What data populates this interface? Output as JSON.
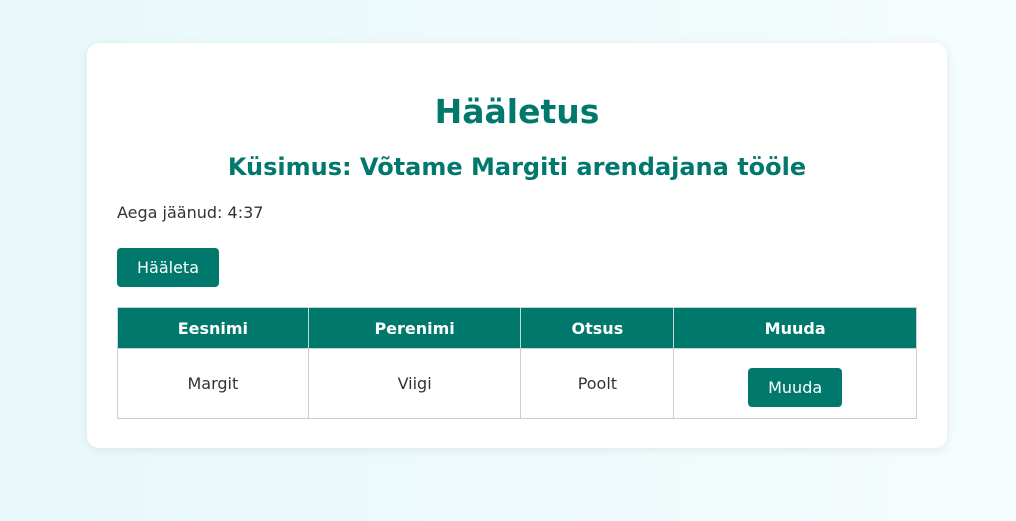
{
  "page": {
    "title": "Hääletus",
    "question": "Küsimus: Võtame Margiti arendajana tööle",
    "timer": "Aega jäänud: 4:37",
    "vote_button": "Hääleta"
  },
  "table": {
    "headers": [
      "Eesnimi",
      "Perenimi",
      "Otsus",
      "Muuda"
    ],
    "rows": [
      {
        "first_name": "Margit",
        "last_name": "Viigi",
        "decision": "Poolt",
        "edit_label": "Muuda"
      }
    ]
  },
  "colors": {
    "accent": "#00786b",
    "card": "#ffffff",
    "background": "#eef9fb"
  }
}
